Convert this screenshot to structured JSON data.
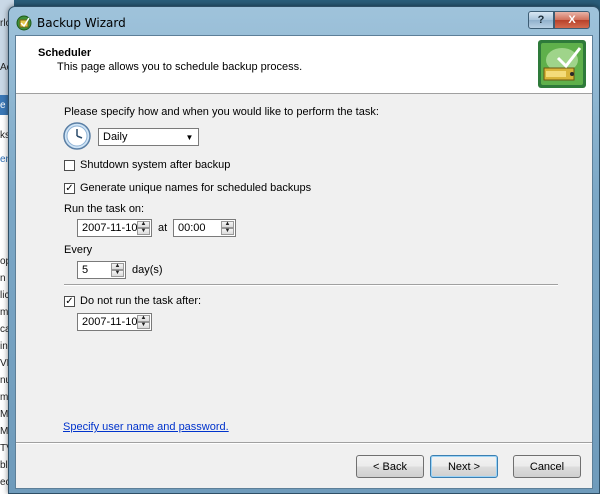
{
  "background_app": {
    "lines": [
      "rlc",
      "Acti",
      "e",
      "ks",
      "ent",
      "op",
      "n",
      "lic",
      "mp",
      "ca",
      "in",
      "VD",
      "nu",
      "m",
      "Mi",
      "Mi",
      "TV",
      "bl",
      "ec"
    ]
  },
  "window": {
    "title": "Backup Wizard",
    "help_label": "?",
    "close_label": "X"
  },
  "header": {
    "title": "Scheduler",
    "subtitle": "This page allows you to schedule backup process."
  },
  "form": {
    "prompt": "Please specify how and when you would like to perform the task:",
    "frequency": {
      "selected": "Daily"
    },
    "shutdown": {
      "label": "Shutdown system after backup",
      "checked": false
    },
    "unique_names": {
      "label": "Generate unique names for scheduled backups",
      "checked": true
    },
    "run_on": {
      "label": "Run the task on:",
      "date": "2007-11-10",
      "at_label": "at",
      "time": "00:00"
    },
    "every": {
      "label": "Every",
      "value": "5",
      "unit": "day(s)"
    },
    "not_after": {
      "label": "Do not run the task after:",
      "checked": true,
      "date": "2007-11-10"
    },
    "credentials_link": "Specify user name and password."
  },
  "buttons": {
    "back": "< Back",
    "next": "Next >",
    "cancel": "Cancel"
  },
  "icons": {
    "check_mark": "✓",
    "up_arrow": "▲",
    "down_arrow": "▼"
  }
}
